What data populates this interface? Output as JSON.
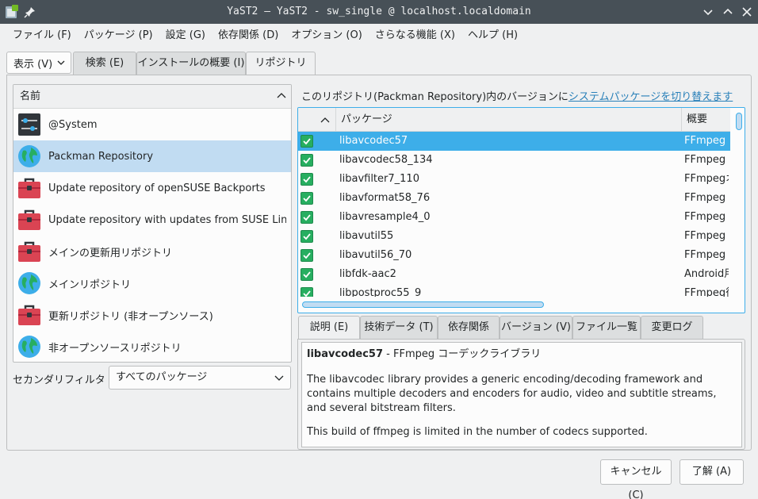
{
  "window": {
    "title": "YaST2 — YaST2 - sw_single @ localhost.localdomain"
  },
  "menu": [
    "ファイル (F)",
    "パッケージ (P)",
    "設定 (G)",
    "依存関係 (D)",
    "オプション (O)",
    "さらなる機能 (X)",
    "ヘルプ (H)"
  ],
  "view_button": "表示 (V)",
  "top_tabs": [
    "検索 (E)",
    "インストールの概要 (I)",
    "リポジトリ (R)"
  ],
  "repo_list": {
    "header": "名前",
    "items": [
      {
        "label": "@System",
        "icon": "system-icon"
      },
      {
        "label": "Packman Repository",
        "icon": "globe-icon"
      },
      {
        "label": "Update repository of openSUSE Backports",
        "icon": "toolbox-icon"
      },
      {
        "label": "Update repository with updates from SUSE Linu...",
        "icon": "toolbox-icon"
      },
      {
        "label": "メインの更新用リポジトリ",
        "icon": "toolbox-icon"
      },
      {
        "label": "メインリポジトリ",
        "icon": "globe-icon"
      },
      {
        "label": "更新リポジトリ (非オープンソース)",
        "icon": "toolbox-icon"
      },
      {
        "label": "非オープンソースリポジトリ",
        "icon": "globe-icon"
      }
    ]
  },
  "secondary_filter": {
    "label": "セカンダリフィルタ (S):",
    "value": "すべてのパッケージ"
  },
  "notice": {
    "text": "このリポジトリ(Packman Repository)内のバージョンに",
    "link": "システムパッケージを切り替えます"
  },
  "package_table": {
    "headers": [
      "パッケージ",
      "概要"
    ],
    "rows": [
      {
        "name": "libavcodec57",
        "summary": "FFmpeg コ"
      },
      {
        "name": "libavcodec58_134",
        "summary": "FFmpeg コ"
      },
      {
        "name": "libavfilter7_110",
        "summary": "FFmpegオ"
      },
      {
        "name": "libavformat58_76",
        "summary": "FFmpeg コ"
      },
      {
        "name": "libavresample4_0",
        "summary": "FFmpeg 付"
      },
      {
        "name": "libavutil55",
        "summary": "FFmpeg ユ"
      },
      {
        "name": "libavutil56_70",
        "summary": "FFmpeg ユ"
      },
      {
        "name": "libfdk-aac2",
        "summary": "Android用"
      },
      {
        "name": "libpostproc55_9",
        "summary": "FFmpeg後"
      }
    ]
  },
  "detail_tabs": [
    "説明 (E)",
    "技術データ (T)",
    "依存関係",
    "バージョン (V)",
    "ファイル一覧",
    "変更ログ"
  ],
  "description": {
    "package": "libavcodec57",
    "summary": " - FFmpeg コーデックライブラリ",
    "paragraphs": [
      "The libavcodec library provides a generic encoding/decoding framework and contains multiple decoders and encoders for audio, video and subtitle streams, and several bitstream filters.",
      "This build of ffmpeg is limited in the number of codecs supported."
    ]
  },
  "buttons": {
    "cancel": "キャンセル (C)",
    "accept": "了解 (A)"
  },
  "colors": {
    "accent": "#3daee9",
    "selection": "#c1dcf2",
    "check": "#27ae60",
    "titlebar": "#475057",
    "toolbox": "#da4453"
  }
}
